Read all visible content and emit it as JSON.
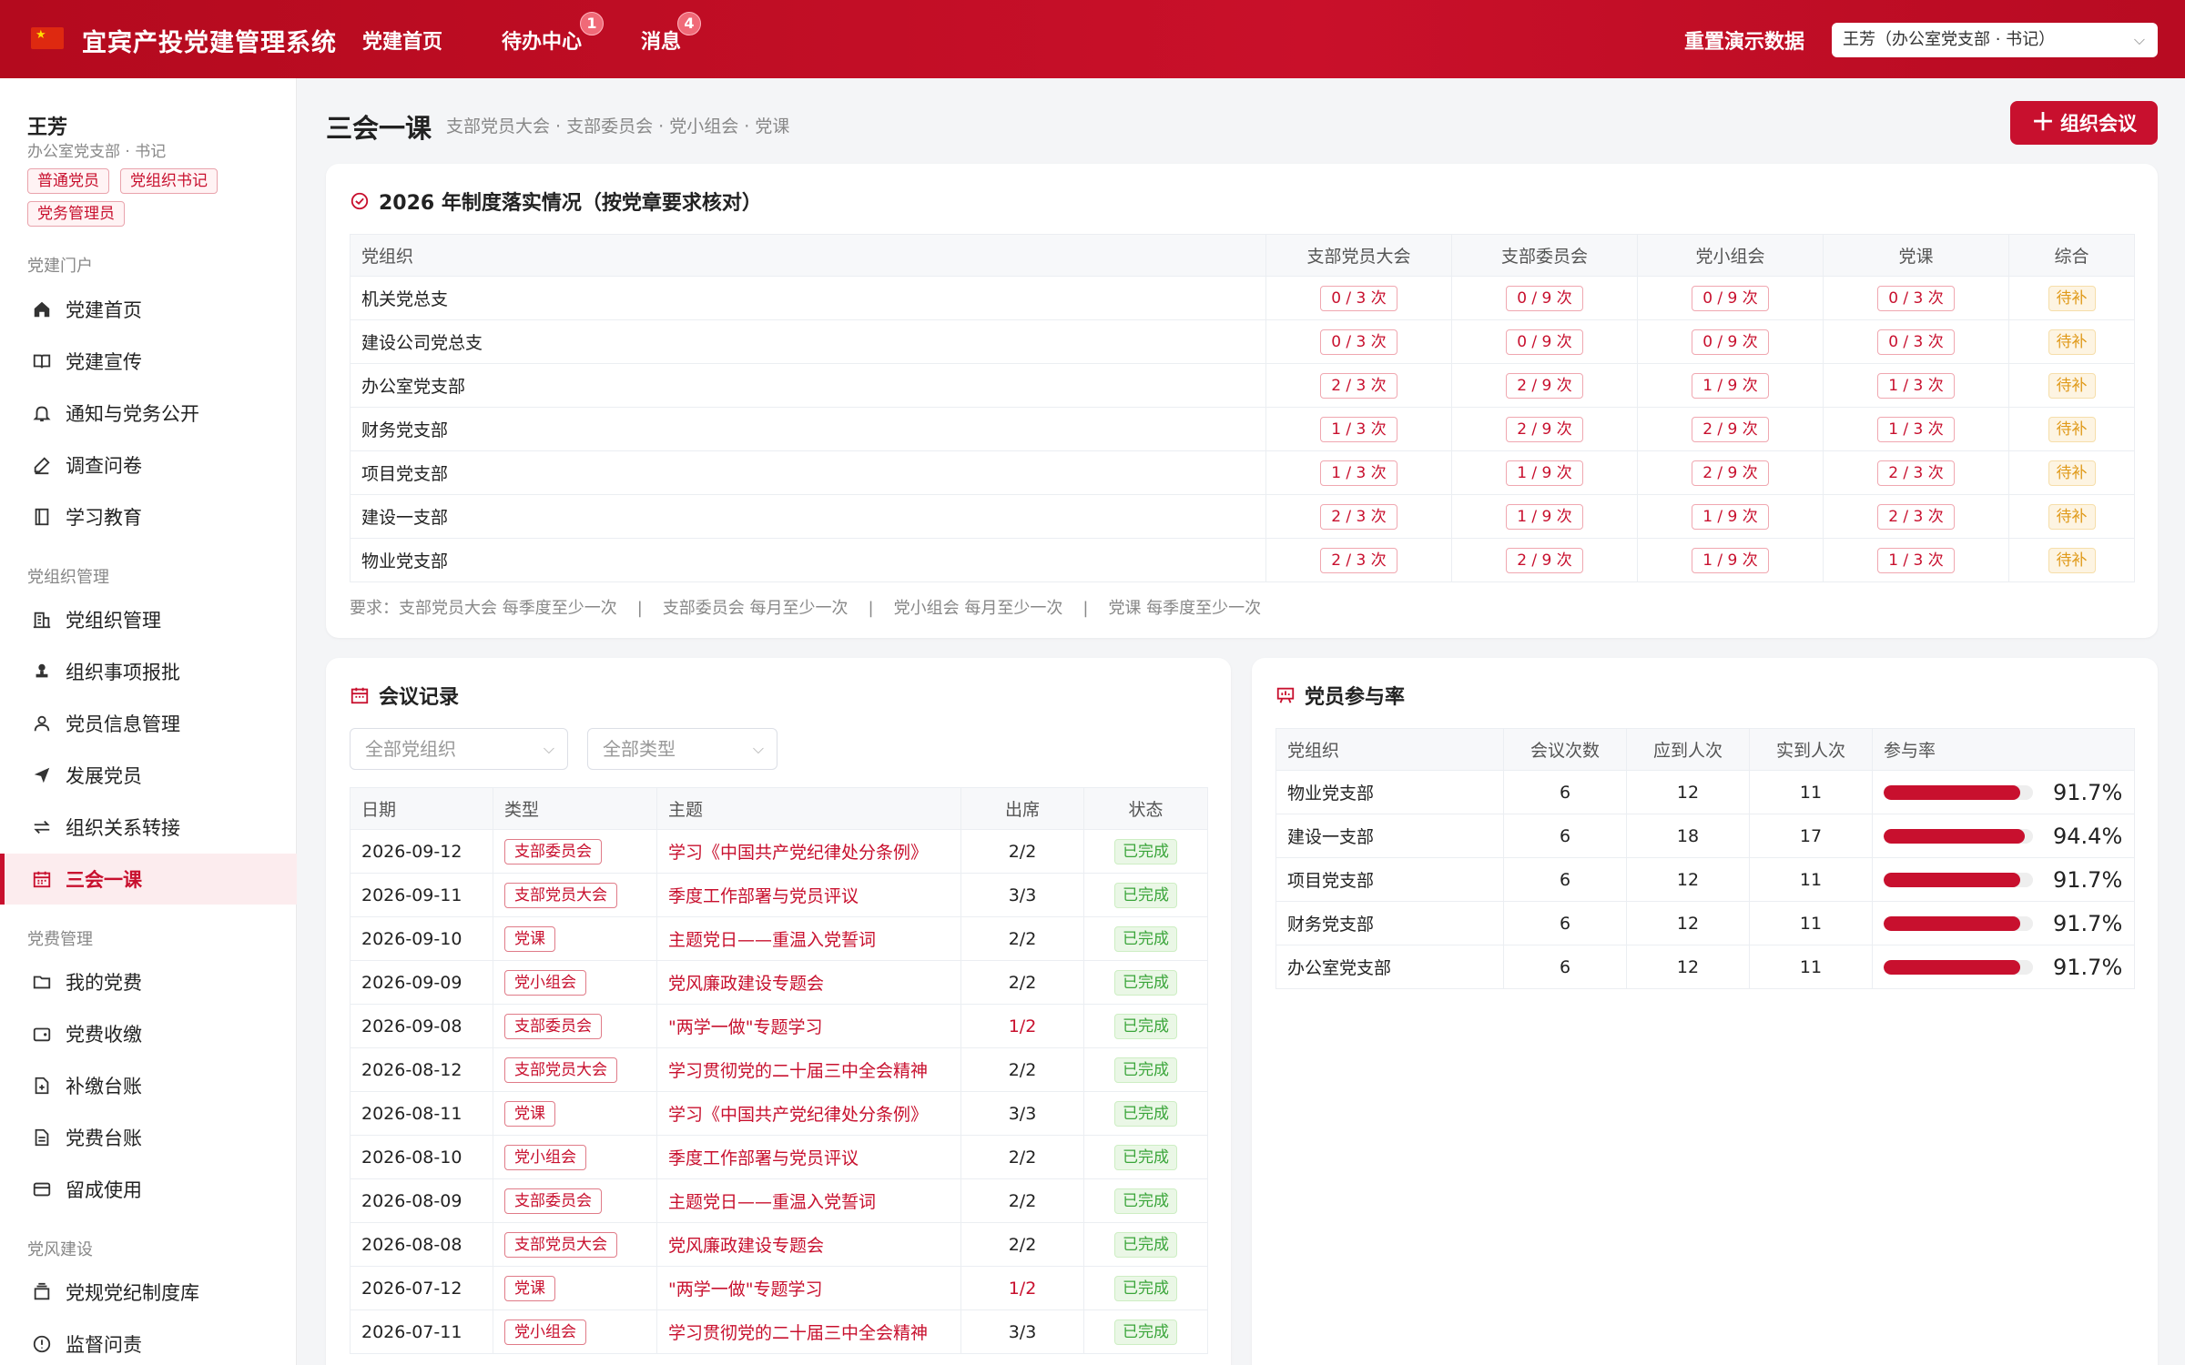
{
  "app": {
    "title": "宜宾产投党建管理系统"
  },
  "nav": [
    {
      "label": "党建首页",
      "badge": ""
    },
    {
      "label": "待办中心",
      "badge": "1"
    },
    {
      "label": "消息",
      "badge": "4"
    }
  ],
  "header": {
    "reset_label": "重置演示数据",
    "user_select": "王芳（办公室党支部 · 书记）"
  },
  "user": {
    "name": "王芳",
    "org": "办公室党支部 · 书记",
    "tags": [
      "普通党员",
      "党组织书记",
      "党务管理员"
    ]
  },
  "sidebar": {
    "groups": [
      {
        "title": "党建门户",
        "items": [
          {
            "label": "党建首页",
            "icon": "home-icon"
          },
          {
            "label": "党建宣传",
            "icon": "book-icon"
          },
          {
            "label": "通知与党务公开",
            "icon": "bell-icon"
          },
          {
            "label": "调查问卷",
            "icon": "pen-icon"
          },
          {
            "label": "学习教育",
            "icon": "notebook-icon"
          }
        ]
      },
      {
        "title": "党组织管理",
        "items": [
          {
            "label": "党组织管理",
            "icon": "building-icon"
          },
          {
            "label": "组织事项报批",
            "icon": "stamp-icon"
          },
          {
            "label": "党员信息管理",
            "icon": "user-icon"
          },
          {
            "label": "发展党员",
            "icon": "send-icon"
          },
          {
            "label": "组织关系转接",
            "icon": "transfer-icon"
          },
          {
            "label": "三会一课",
            "icon": "calendar-icon",
            "active": true
          }
        ]
      },
      {
        "title": "党费管理",
        "items": [
          {
            "label": "我的党费",
            "icon": "folder-icon"
          },
          {
            "label": "党费收缴",
            "icon": "wallet-icon"
          },
          {
            "label": "补缴台账",
            "icon": "file-plus-icon"
          },
          {
            "label": "党费台账",
            "icon": "document-icon"
          },
          {
            "label": "留成使用",
            "icon": "card-icon"
          }
        ]
      },
      {
        "title": "党风建设",
        "items": [
          {
            "label": "党规党纪制度库",
            "icon": "library-icon"
          },
          {
            "label": "监督问责",
            "icon": "alert-icon"
          }
        ]
      }
    ]
  },
  "page": {
    "title": "三会一课",
    "subtitle": "支部党员大会 · 支部委员会 · 党小组会 · 党课",
    "org_button": "组织会议"
  },
  "compliance": {
    "title": "2026 年制度落实情况（按党章要求核对）",
    "headers": [
      "党组织",
      "支部党员大会",
      "支部委员会",
      "党小组会",
      "党课",
      "综合"
    ],
    "rows": [
      {
        "org": "机关党总支",
        "a": "0 / 3 次",
        "b": "0 / 9 次",
        "c": "0 / 9 次",
        "d": "0 / 3 次",
        "status": "待补"
      },
      {
        "org": "建设公司党总支",
        "a": "0 / 3 次",
        "b": "0 / 9 次",
        "c": "0 / 9 次",
        "d": "0 / 3 次",
        "status": "待补"
      },
      {
        "org": "办公室党支部",
        "a": "2 / 3 次",
        "b": "2 / 9 次",
        "c": "1 / 9 次",
        "d": "1 / 3 次",
        "status": "待补"
      },
      {
        "org": "财务党支部",
        "a": "1 / 3 次",
        "b": "2 / 9 次",
        "c": "2 / 9 次",
        "d": "1 / 3 次",
        "status": "待补"
      },
      {
        "org": "项目党支部",
        "a": "1 / 3 次",
        "b": "1 / 9 次",
        "c": "2 / 9 次",
        "d": "2 / 3 次",
        "status": "待补"
      },
      {
        "org": "建设一支部",
        "a": "2 / 3 次",
        "b": "1 / 9 次",
        "c": "1 / 9 次",
        "d": "2 / 3 次",
        "status": "待补"
      },
      {
        "org": "物业党支部",
        "a": "2 / 3 次",
        "b": "2 / 9 次",
        "c": "1 / 9 次",
        "d": "1 / 3 次",
        "status": "待补"
      }
    ],
    "requirements": [
      "要求：支部党员大会 每季度至少一次",
      "支部委员会 每月至少一次",
      "党小组会 每月至少一次",
      "党课 每季度至少一次"
    ]
  },
  "meetings": {
    "title": "会议记录",
    "filter_org": "全部党组织",
    "filter_type": "全部类型",
    "headers": [
      "日期",
      "类型",
      "主题",
      "出席",
      "状态"
    ],
    "rows": [
      {
        "date": "2026-09-12",
        "type": "支部委员会",
        "topic": "学习《中国共产党纪律处分条例》",
        "att": "2/2",
        "low": false,
        "status": "已完成"
      },
      {
        "date": "2026-09-11",
        "type": "支部党员大会",
        "topic": "季度工作部署与党员评议",
        "att": "3/3",
        "low": false,
        "status": "已完成"
      },
      {
        "date": "2026-09-10",
        "type": "党课",
        "topic": "主题党日——重温入党誓词",
        "att": "2/2",
        "low": false,
        "status": "已完成"
      },
      {
        "date": "2026-09-09",
        "type": "党小组会",
        "topic": "党风廉政建设专题会",
        "att": "2/2",
        "low": false,
        "status": "已完成"
      },
      {
        "date": "2026-09-08",
        "type": "支部委员会",
        "topic": "\"两学一做\"专题学习",
        "att": "1/2",
        "low": true,
        "status": "已完成"
      },
      {
        "date": "2026-08-12",
        "type": "支部党员大会",
        "topic": "学习贯彻党的二十届三中全会精神",
        "att": "2/2",
        "low": false,
        "status": "已完成"
      },
      {
        "date": "2026-08-11",
        "type": "党课",
        "topic": "学习《中国共产党纪律处分条例》",
        "att": "3/3",
        "low": false,
        "status": "已完成"
      },
      {
        "date": "2026-08-10",
        "type": "党小组会",
        "topic": "季度工作部署与党员评议",
        "att": "2/2",
        "low": false,
        "status": "已完成"
      },
      {
        "date": "2026-08-09",
        "type": "支部委员会",
        "topic": "主题党日——重温入党誓词",
        "att": "2/2",
        "low": false,
        "status": "已完成"
      },
      {
        "date": "2026-08-08",
        "type": "支部党员大会",
        "topic": "党风廉政建设专题会",
        "att": "2/2",
        "low": false,
        "status": "已完成"
      },
      {
        "date": "2026-07-12",
        "type": "党课",
        "topic": "\"两学一做\"专题学习",
        "att": "1/2",
        "low": true,
        "status": "已完成"
      },
      {
        "date": "2026-07-11",
        "type": "党小组会",
        "topic": "学习贯彻党的二十届三中全会精神",
        "att": "3/3",
        "low": false,
        "status": "已完成"
      }
    ]
  },
  "participation": {
    "title": "党员参与率",
    "headers": [
      "党组织",
      "会议次数",
      "应到人次",
      "实到人次",
      "参与率"
    ],
    "rows": [
      {
        "org": "物业党支部",
        "meetings": "6",
        "expected": "12",
        "actual": "11",
        "rate": 0.917,
        "rate_label": "91.7%"
      },
      {
        "org": "建设一支部",
        "meetings": "6",
        "expected": "18",
        "actual": "17",
        "rate": 0.944,
        "rate_label": "94.4%"
      },
      {
        "org": "项目党支部",
        "meetings": "6",
        "expected": "12",
        "actual": "11",
        "rate": 0.917,
        "rate_label": "91.7%"
      },
      {
        "org": "财务党支部",
        "meetings": "6",
        "expected": "12",
        "actual": "11",
        "rate": 0.917,
        "rate_label": "91.7%"
      },
      {
        "org": "办公室党支部",
        "meetings": "6",
        "expected": "12",
        "actual": "11",
        "rate": 0.917,
        "rate_label": "91.7%"
      }
    ]
  },
  "colors": {
    "brand": "#c8102e",
    "done": "#3aa53a",
    "pending": "#e09a1a"
  }
}
